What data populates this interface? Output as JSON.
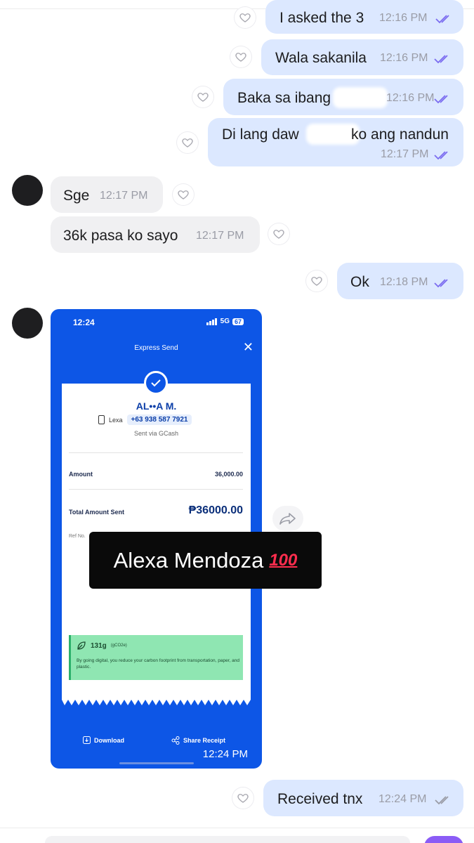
{
  "messages": {
    "m1": {
      "text": "I asked the 3",
      "time": "12:16 PM"
    },
    "m2": {
      "text": "Wala sakanila",
      "time": "12:16 PM"
    },
    "m3": {
      "text": "Baka sa ibang",
      "time": "12:16 PM"
    },
    "m4": {
      "text_start": "Di lang daw",
      "text_end": "ko ang nandun",
      "time": "12:17 PM"
    },
    "m5": {
      "text": "Sge",
      "time": "12:17 PM"
    },
    "m6": {
      "text": "36k pasa ko sayo",
      "time": "12:17 PM"
    },
    "m7": {
      "text": "Ok",
      "time": "12:18 PM"
    },
    "m8": {
      "text": "Received tnx",
      "time": "12:24 PM"
    }
  },
  "receipt": {
    "status_time": "12:24",
    "network": "5G",
    "battery": "67",
    "title": "Express Send",
    "recipient_name": "AL••A M.",
    "recipient_tag": "Lexa",
    "recipient_phone": "+63 938 587 7921",
    "sent_via": "Sent via GCash",
    "amount_label": "Amount",
    "amount_value": "36,000.00",
    "total_label": "Total Amount Sent",
    "total_value": "₱36000.00",
    "ref_label": "Ref No.",
    "eco_amount": "131g",
    "eco_unit": "(gCO2e)",
    "eco_text": "By going digital, you reduce your carbon footprint from transportation, paper, and plastic.",
    "download_label": "Download",
    "share_label": "Share Receipt",
    "message_time": "12:24 PM"
  },
  "overlay": {
    "text": "Alexa Mendoza",
    "emoji": "100"
  },
  "colors": {
    "outgoing_bubble": "#dce8ff",
    "incoming_bubble": "#f0f0f2",
    "gcash_blue": "#0d56e6",
    "read_check": "#7b6cf0",
    "send_button": "#8b5cf6"
  },
  "icons": [
    "heart-icon",
    "double-check-icon",
    "share-forward-icon",
    "close-icon",
    "check-icon",
    "leaf-icon",
    "download-icon",
    "share-icon"
  ]
}
